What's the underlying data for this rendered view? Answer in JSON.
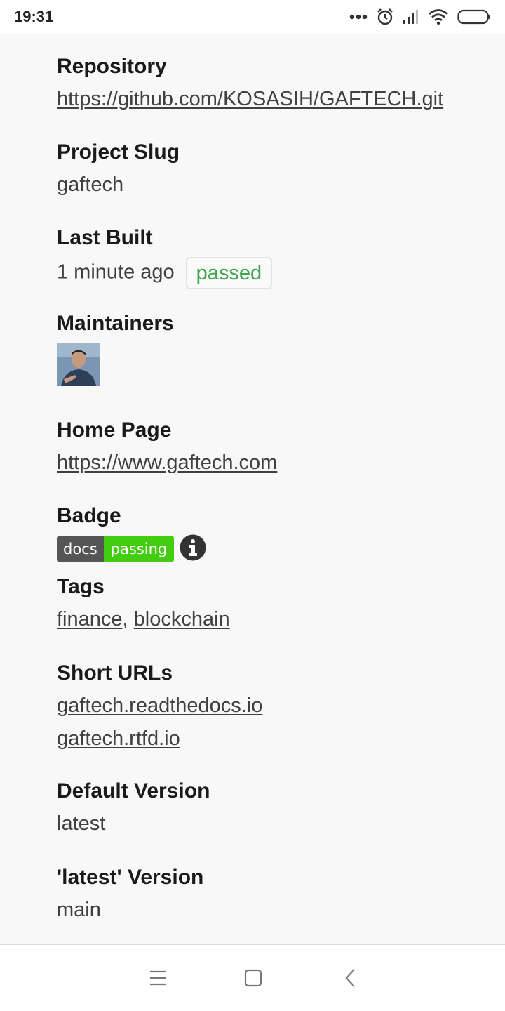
{
  "status_bar": {
    "time": "19:31",
    "icons": [
      "more-dots-icon",
      "alarm-icon",
      "signal-icon",
      "wifi-icon",
      "battery-icon"
    ]
  },
  "project": {
    "repository": {
      "label": "Repository",
      "value": "https://github.com/KOSASIH/GAFTECH.git"
    },
    "slug": {
      "label": "Project Slug",
      "value": "gaftech"
    },
    "last_built": {
      "label": "Last Built",
      "value": "1 minute ago",
      "status": "passed"
    },
    "maintainers": {
      "label": "Maintainers"
    },
    "home_page": {
      "label": "Home Page",
      "value": "https://www.gaftech.com"
    },
    "badge": {
      "label": "Badge",
      "left": "docs",
      "right": "passing"
    },
    "tags": {
      "label": "Tags",
      "items": [
        "finance",
        "blockchain"
      ],
      "separator": ","
    },
    "short_urls": {
      "label": "Short URLs",
      "items": [
        "gaftech.readthedocs.io",
        "gaftech.rtfd.io"
      ]
    },
    "default_version": {
      "label": "Default Version",
      "value": "latest"
    },
    "latest_version": {
      "label": "'latest' Version",
      "value": "main"
    }
  },
  "colors": {
    "passed": "#3fa44a",
    "badge_left": "#555555",
    "badge_right": "#44cc11"
  },
  "nav_bar": {
    "icons": [
      "menu-icon",
      "home-square-icon",
      "back-icon"
    ]
  }
}
